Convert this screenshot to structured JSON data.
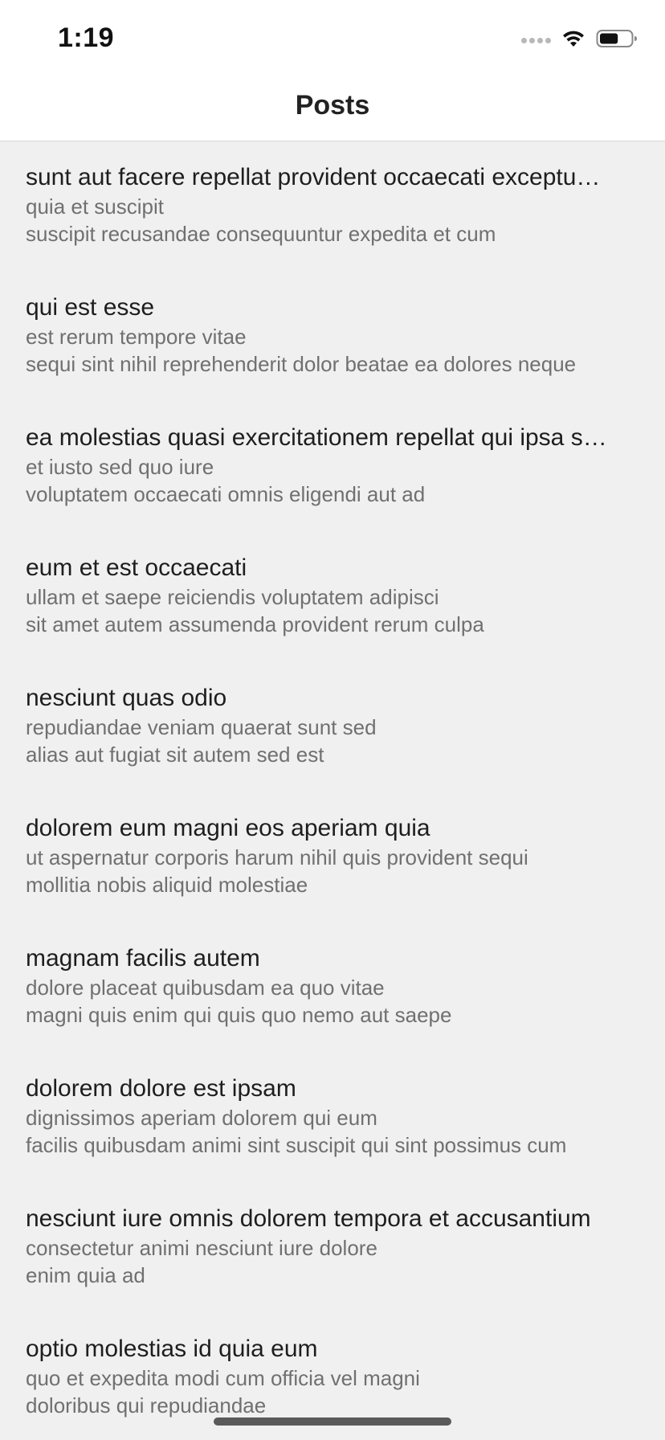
{
  "status_bar": {
    "time": "1:19",
    "signal_icon": "signal-dots-icon",
    "wifi_icon": "wifi-icon",
    "battery_icon": "battery-icon",
    "battery_level": 0.6
  },
  "nav": {
    "title": "Posts"
  },
  "posts": [
    {
      "title": "sunt aut facere repellat provident occaecati exceptu…",
      "body_line1": "quia et suscipit",
      "body_line2": "suscipit recusandae consequuntur expedita et cum"
    },
    {
      "title": "qui est esse",
      "body_line1": "est rerum tempore vitae",
      "body_line2": "sequi sint nihil reprehenderit dolor beatae ea dolores neque"
    },
    {
      "title": "ea molestias quasi exercitationem repellat qui ipsa s…",
      "body_line1": "et iusto sed quo iure",
      "body_line2": "voluptatem occaecati omnis eligendi aut ad"
    },
    {
      "title": "eum et est occaecati",
      "body_line1": "ullam et saepe reiciendis voluptatem adipisci",
      "body_line2": "sit amet autem assumenda provident rerum culpa"
    },
    {
      "title": "nesciunt quas odio",
      "body_line1": "repudiandae veniam quaerat sunt sed",
      "body_line2": "alias aut fugiat sit autem sed est"
    },
    {
      "title": "dolorem eum magni eos aperiam quia",
      "body_line1": "ut aspernatur corporis harum nihil quis provident sequi",
      "body_line2": "mollitia nobis aliquid molestiae"
    },
    {
      "title": "magnam facilis autem",
      "body_line1": "dolore placeat quibusdam ea quo vitae",
      "body_line2": "magni quis enim qui quis quo nemo aut saepe"
    },
    {
      "title": "dolorem dolore est ipsam",
      "body_line1": "dignissimos aperiam dolorem qui eum",
      "body_line2": "facilis quibusdam animi sint suscipit qui sint possimus cum"
    },
    {
      "title": "nesciunt iure omnis dolorem tempora et accusantium",
      "body_line1": "consectetur animi nesciunt iure dolore",
      "body_line2": "enim quia ad"
    },
    {
      "title": "optio molestias id quia eum",
      "body_line1": "quo et expedita modi cum officia vel magni",
      "body_line2": "doloribus qui repudiandae"
    }
  ]
}
